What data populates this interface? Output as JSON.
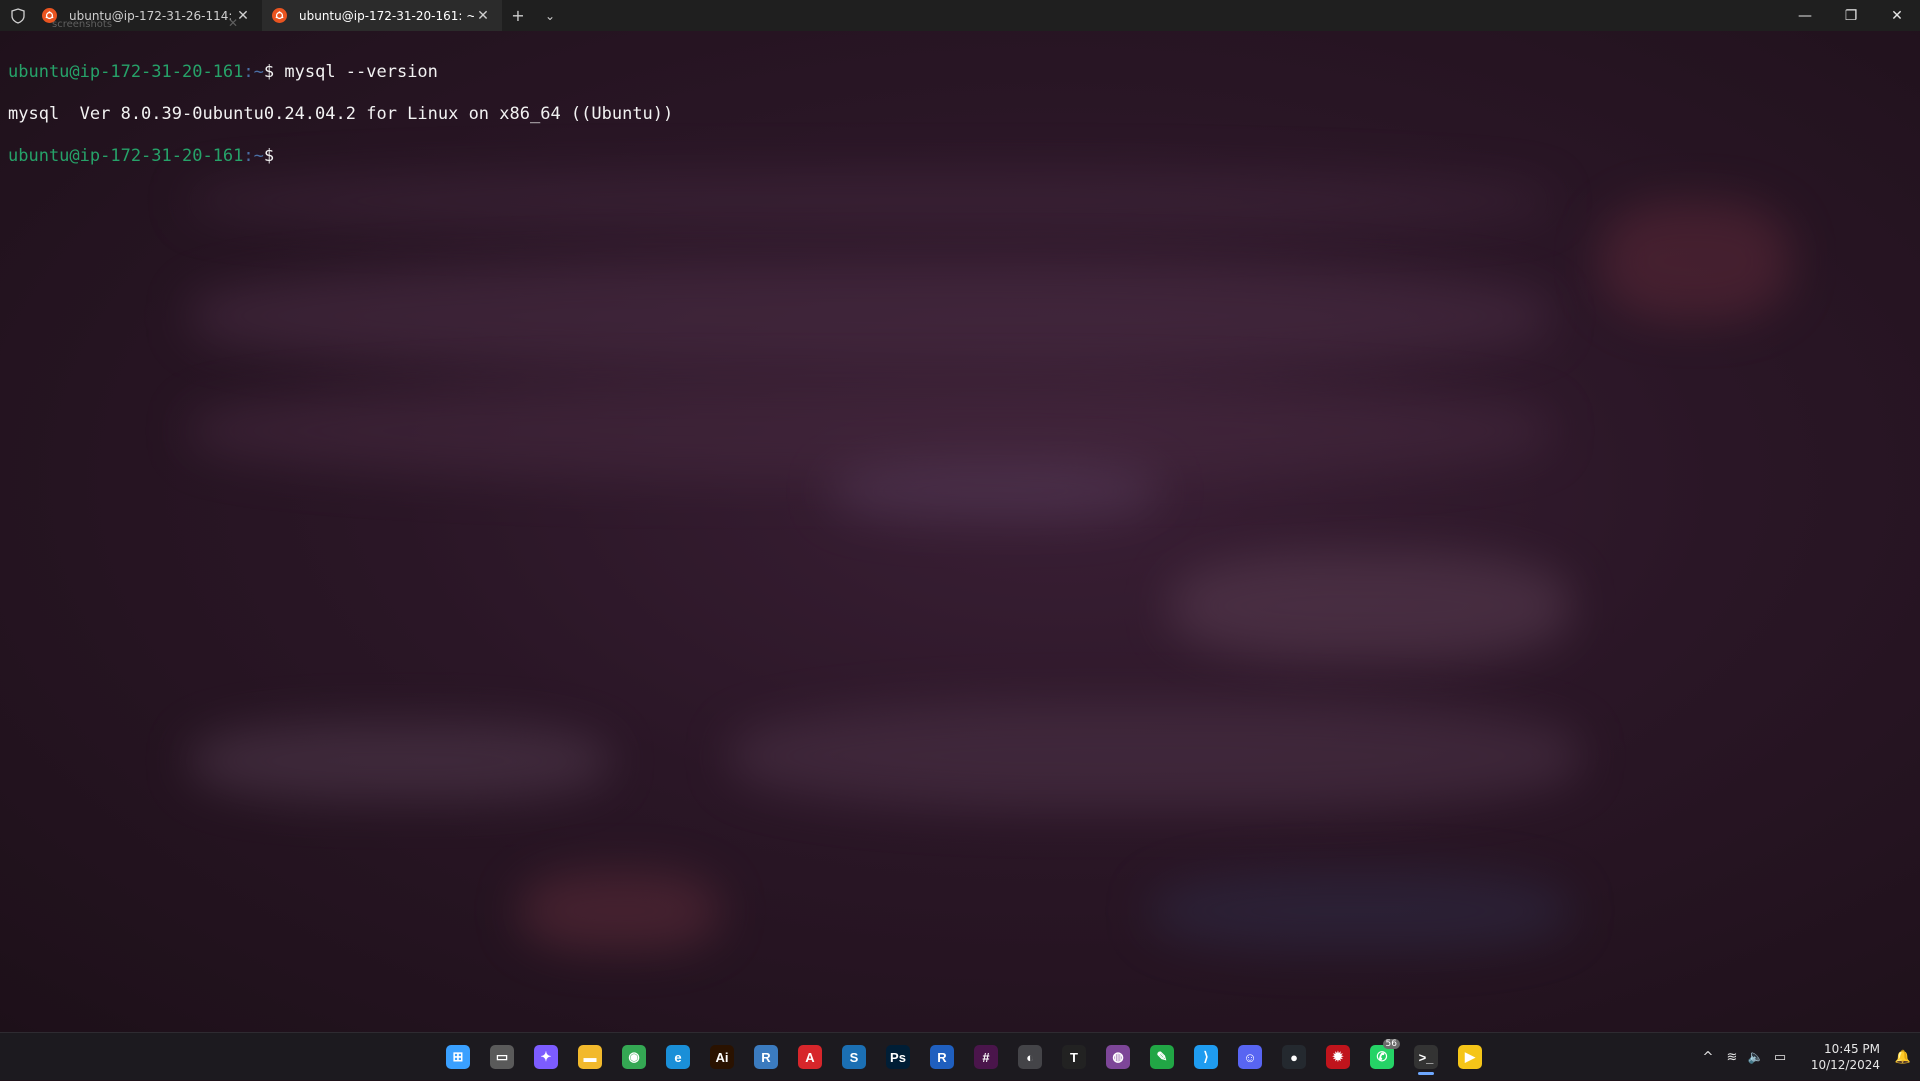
{
  "window": {
    "tabs": [
      {
        "label": "ubuntu@ip-172-31-26-114: ~",
        "active": false
      },
      {
        "label": "ubuntu@ip-172-31-20-161: ~",
        "active": true
      }
    ],
    "ghost_label": "screenshots",
    "new_tab": "+",
    "dropdown": "⌄",
    "minimize": "—",
    "restore": "❐",
    "close": "✕"
  },
  "terminal": {
    "lines": [
      {
        "user": "ubuntu@ip-172-31-20-161",
        "path": ":~",
        "symbol": "$ ",
        "command": "mysql --version"
      },
      {
        "output": "mysql  Ver 8.0.39-0ubuntu0.24.04.2 for Linux on x86_64 ((Ubuntu))"
      },
      {
        "user": "ubuntu@ip-172-31-20-161",
        "path": ":~",
        "symbol": "$ ",
        "command": ""
      }
    ]
  },
  "taskbar": {
    "apps": [
      {
        "name": "windows-start",
        "icon": "windows-logo-icon",
        "color": "#3aa0ff",
        "glyph": "⊞"
      },
      {
        "name": "task-view",
        "icon": "task-view-icon",
        "color": "#5a5a5a",
        "glyph": "▭"
      },
      {
        "name": "copilot",
        "icon": "copilot-icon",
        "color": "#7c5cff",
        "glyph": "✦"
      },
      {
        "name": "file-explorer",
        "icon": "folder-icon",
        "color": "#f2b92c",
        "glyph": "▬"
      },
      {
        "name": "chrome",
        "icon": "chrome-icon",
        "color": "#34a853",
        "glyph": "◉"
      },
      {
        "name": "edge",
        "icon": "edge-icon",
        "color": "#1a8fd8",
        "glyph": "e"
      },
      {
        "name": "illustrator",
        "icon": "illustrator-icon",
        "color": "#2a1200",
        "glyph": "Ai"
      },
      {
        "name": "revit",
        "icon": "revit-icon",
        "color": "#3b7bbf",
        "glyph": "R"
      },
      {
        "name": "acrobat",
        "icon": "acrobat-icon",
        "color": "#d7262b",
        "glyph": "A"
      },
      {
        "name": "sketchup",
        "icon": "sketchup-icon",
        "color": "#1b6fb3",
        "glyph": "S"
      },
      {
        "name": "photoshop",
        "icon": "photoshop-icon",
        "color": "#001e36",
        "glyph": "Ps"
      },
      {
        "name": "rider",
        "icon": "rider-icon",
        "color": "#1f5fbf",
        "glyph": "R"
      },
      {
        "name": "slack",
        "icon": "slack-icon",
        "color": "#4a154b",
        "glyph": "#"
      },
      {
        "name": "obs",
        "icon": "obs-icon",
        "color": "#444448",
        "glyph": "◐"
      },
      {
        "name": "typora",
        "icon": "typora-icon",
        "color": "#222222",
        "glyph": "T"
      },
      {
        "name": "tor-browser",
        "icon": "tor-icon",
        "color": "#7d4698",
        "glyph": "◍"
      },
      {
        "name": "notepad",
        "icon": "notepad-icon",
        "color": "#21a645",
        "glyph": "✎"
      },
      {
        "name": "vscode",
        "icon": "vscode-icon",
        "color": "#1f9cf0",
        "glyph": "⟩"
      },
      {
        "name": "discord",
        "icon": "discord-icon",
        "color": "#5865f2",
        "glyph": "☺"
      },
      {
        "name": "github-desktop",
        "icon": "github-icon",
        "color": "#24292f",
        "glyph": "●"
      },
      {
        "name": "security-app",
        "icon": "shield-red-icon",
        "color": "#c0141c",
        "glyph": "✹"
      },
      {
        "name": "whatsapp",
        "icon": "whatsapp-icon",
        "color": "#25d366",
        "glyph": "✆",
        "badge": "56"
      },
      {
        "name": "terminal",
        "icon": "terminal-icon",
        "color": "#333333",
        "glyph": ">_",
        "active": true
      },
      {
        "name": "player",
        "icon": "player-icon",
        "color": "#f5c518",
        "glyph": "▶"
      }
    ],
    "tray": {
      "chevron": "^",
      "wifi": "≋",
      "volume": "🔈",
      "battery": "▭",
      "time": "10:45 PM",
      "date": "10/12/2024",
      "notification": "🔔"
    }
  },
  "colors": {
    "prompt_user": "#26a269",
    "prompt_path": "#4a6fa5",
    "terminal_bg": "#2a1626",
    "titlebar_bg": "#1f1f1f",
    "taskbar_bg": "#1c1a1f"
  }
}
